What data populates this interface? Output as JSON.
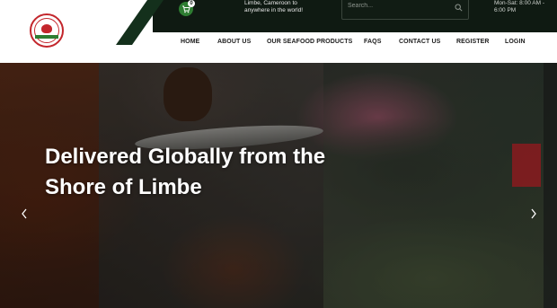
{
  "topbar": {
    "cart_count": "0",
    "shipping_text": "Limbe, Cameroon to anywhere in the world!",
    "search_placeholder": "Search...",
    "hours": "Mon-Sat: 8:00 AM - 6:00 PM"
  },
  "nav": {
    "items": [
      "HOME",
      "ABOUT US",
      "OUR SEAFOOD PRODUCTS",
      "FAQS",
      "CONTACT US",
      "REGISTER",
      "LOGIN"
    ]
  },
  "hero": {
    "title": "Delivered Globally from the Shore of Limbe"
  },
  "icons": {
    "cart": "shopping-cart-icon",
    "search": "search-icon",
    "prev": "chevron-left-icon",
    "next": "chevron-right-icon"
  },
  "colors": {
    "brand_green": "#2e7d32",
    "brand_red": "#c3262c",
    "topbar_dark": "#0f1a12"
  }
}
